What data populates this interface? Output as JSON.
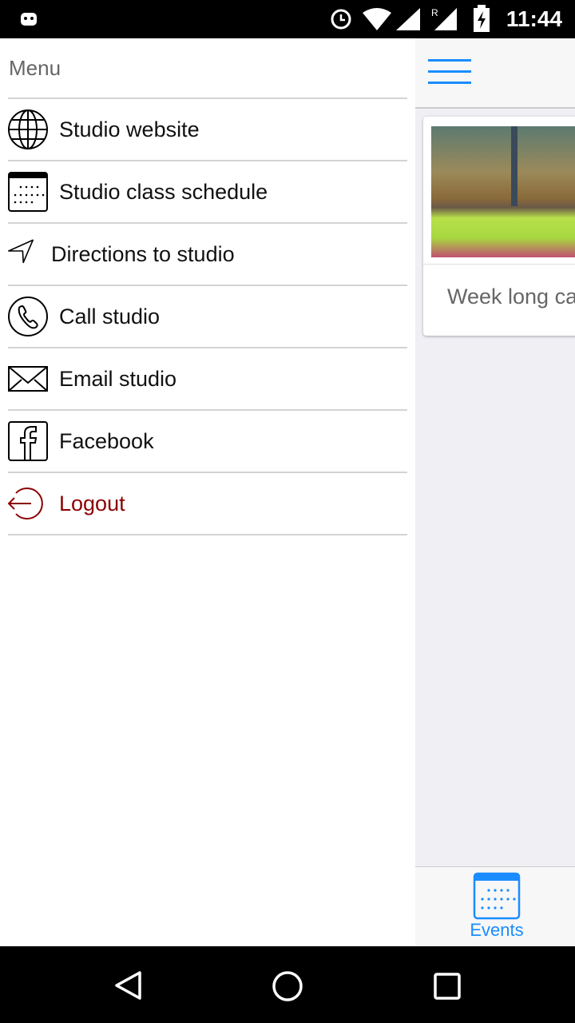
{
  "status_bar": {
    "time": "11:44",
    "icons": [
      "android-icon",
      "alarm-icon",
      "wifi-icon",
      "signal-icon",
      "roaming-signal-icon",
      "battery-charging-icon"
    ]
  },
  "drawer": {
    "title": "Menu",
    "items": [
      {
        "label": "Studio website",
        "icon": "globe-icon"
      },
      {
        "label": "Studio class schedule",
        "icon": "calendar-icon"
      },
      {
        "label": "Directions to studio",
        "icon": "navigation-arrow-icon"
      },
      {
        "label": "Call studio",
        "icon": "phone-icon"
      },
      {
        "label": "Email studio",
        "icon": "envelope-icon"
      },
      {
        "label": "Facebook",
        "icon": "facebook-icon"
      },
      {
        "label": "Logout",
        "icon": "logout-icon"
      }
    ]
  },
  "main": {
    "card_text": "Week long ca",
    "tab": {
      "label": "Events",
      "icon": "calendar-icon"
    }
  },
  "colors": {
    "accent": "#1a8cff",
    "logout": "#8b0000"
  }
}
